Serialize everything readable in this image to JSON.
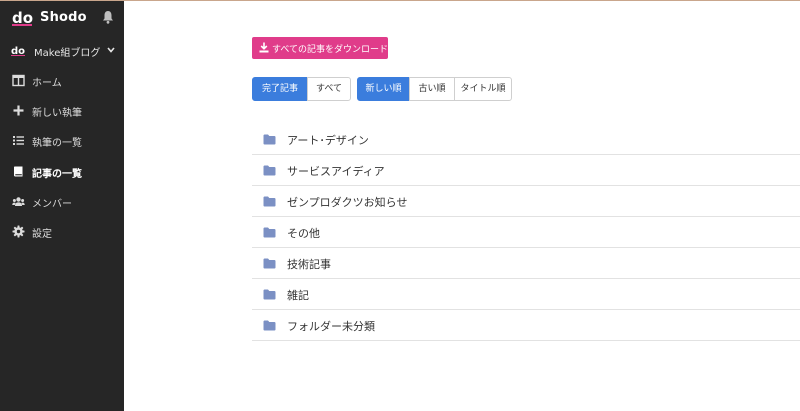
{
  "app": {
    "name": "Shodo",
    "logo_text": "do",
    "team_name": "Make組ブログ"
  },
  "sidebar": {
    "items": [
      {
        "label": "ホーム",
        "icon": "columns-icon"
      },
      {
        "label": "新しい執筆",
        "icon": "plus-icon"
      },
      {
        "label": "執筆の一覧",
        "icon": "list-icon"
      },
      {
        "label": "記事の一覧",
        "icon": "book-icon",
        "active": true
      },
      {
        "label": "メンバー",
        "icon": "users-icon"
      },
      {
        "label": "設定",
        "icon": "gear-icon"
      }
    ]
  },
  "main": {
    "download_label": "すべての記事をダウンロード",
    "status_filter": [
      {
        "label": "完了記事",
        "active": true
      },
      {
        "label": "すべて",
        "active": false
      }
    ],
    "sort_filter": [
      {
        "label": "新しい順",
        "active": true
      },
      {
        "label": "古い順",
        "active": false
      },
      {
        "label": "タイトル順",
        "active": false
      }
    ],
    "folders": [
      "アート･デザイン",
      "サービスアイディア",
      "ゼンプロダクツお知らせ",
      "その他",
      "技術記事",
      "雑記",
      "フォルダー未分類"
    ]
  },
  "colors": {
    "sidebar_bg": "#262626",
    "accent_pink": "#e03c8a",
    "accent_blue": "#3b7ddd",
    "folder_icon": "#7b90c4"
  }
}
